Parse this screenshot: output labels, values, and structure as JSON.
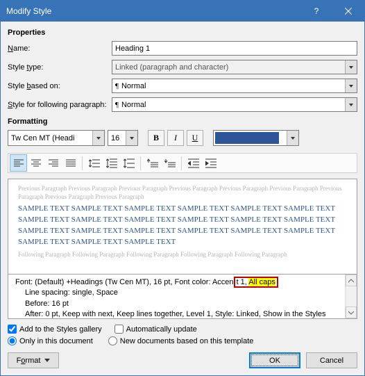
{
  "titlebar": {
    "title": "Modify Style"
  },
  "sections": {
    "properties": "Properties",
    "formatting": "Formatting"
  },
  "properties": {
    "name_label": "Name:",
    "name_value": "Heading 1",
    "type_label": "Style type:",
    "type_value": "Linked (paragraph and character)",
    "based_label": "Style based on:",
    "based_value": "Normal",
    "following_label": "Style for following paragraph:",
    "following_value": "Normal"
  },
  "formatting": {
    "font": "Tw Cen MT (Headi",
    "size": "16",
    "color": "#2e5597"
  },
  "preview": {
    "prev_para": "Previous Paragraph Previous Paragraph Previous Paragraph Previous Paragraph Previous Paragraph Previous Paragraph Previous Paragraph Previous Paragraph Previous Paragraph",
    "sample": "SAMPLE TEXT SAMPLE TEXT SAMPLE TEXT SAMPLE TEXT SAMPLE TEXT SAMPLE TEXT SAMPLE TEXT SAMPLE TEXT SAMPLE TEXT SAMPLE TEXT SAMPLE TEXT SAMPLE TEXT SAMPLE TEXT SAMPLE TEXT SAMPLE TEXT SAMPLE TEXT SAMPLE TEXT SAMPLE TEXT SAMPLE TEXT SAMPLE TEXT SAMPLE TEXT",
    "following_para": "Following Paragraph Following Paragraph Following Paragraph Following Paragraph Following Paragraph"
  },
  "description": {
    "line1_a": "Font: (Default) +Headings (Tw Cen MT), 16 pt, Font color: Accen",
    "line1_b": "t 1, ",
    "line1_c": "All caps",
    "line2": "Line spacing:  single, Space",
    "line3": "Before:  16 pt",
    "line4": "After:   0 pt, Keep with next, Keep lines together, Level 1, Style: Linked, Show in the Styles"
  },
  "options": {
    "add_gallery": "Add to the Styles gallery",
    "auto_update": "Automatically update",
    "only_doc": "Only in this document",
    "new_docs": "New documents based on this template"
  },
  "buttons": {
    "format": "Format",
    "ok": "OK",
    "cancel": "Cancel"
  }
}
